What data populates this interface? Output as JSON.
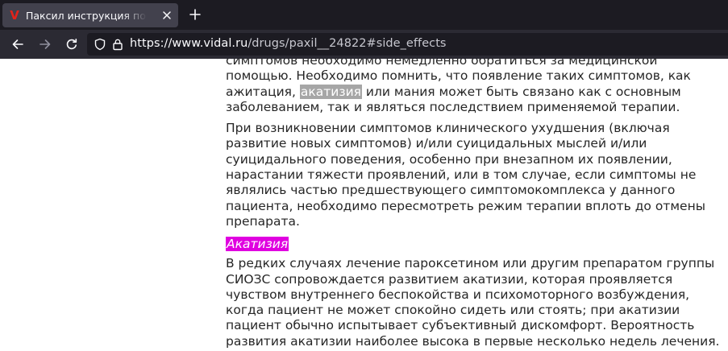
{
  "tab": {
    "favicon_letter": "V",
    "title": "Паксил инструкция по применению"
  },
  "nav": {
    "url_host": "https://www.vidal.ru",
    "url_path": "/drugs/paxil__24822#side_effects"
  },
  "article": {
    "para1_line1": "симптомов необходимо немедленно обратиться за медицинской",
    "para1_line2": "помощью. Необходимо помнить, что появление таких симптомов, как",
    "para1_line3_before": "ажитация, ",
    "para1_highlight": "акатизия",
    "para1_line3_after": " или мания может быть связано как с основным",
    "para1_line4": "заболеванием, так и являться последствием применяемой терапии.",
    "para2_lines": [
      "При возникновении симптомов клинического ухудшения (включая",
      "развитие новых симптомов) и/или суицидальных мыслей и/или",
      "суицидального поведения, особенно при внезапном их появлении,",
      "нарастании тяжести проявлений, или в том случае, если симптомы не",
      "являлись частью предшествующего симптомокомплекса у данного",
      "пациента, необходимо пересмотреть режим терапии вплоть до отмены",
      "препарата."
    ],
    "heading": "Акатизия",
    "para3_lines": [
      "В редких случаях лечение пароксетином или другим препаратом группы",
      "СИОЗС сопровождается развитием акатизии, которая проявляется",
      "чувством внутреннего беспокойства и психомоторного возбуждения,",
      "когда пациент не может спокойно сидеть или стоять; при акатизии",
      "пациент обычно испытывает субъективный дискомфорт. Вероятность",
      "развития акатизии наиболее высока в первые несколько недель лечения."
    ]
  },
  "colors": {
    "tabbar_bg": "#1c1b22",
    "active_tab_bg": "#42414d",
    "navbar_bg": "#2b2a33",
    "heading_highlight": "#e000e0",
    "search_highlight": "#a6a6a6",
    "favicon": "#e2231a"
  },
  "icons": {
    "back": "arrow-left-icon",
    "forward": "arrow-right-icon",
    "reload": "reload-icon",
    "shield": "tracking-protection-shield-icon",
    "lock": "lock-icon",
    "close_tab": "close-icon",
    "new_tab": "plus-icon"
  }
}
